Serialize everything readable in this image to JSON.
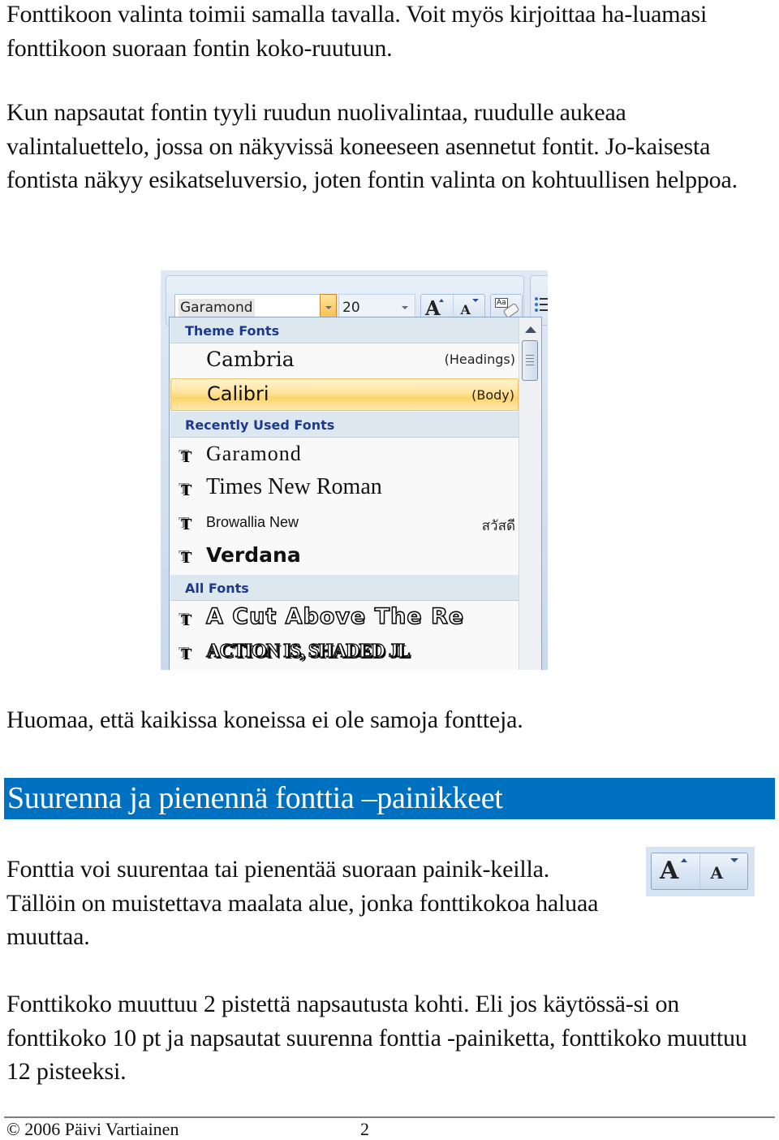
{
  "paragraphs": {
    "p1": "Fonttikoon valinta toimii samalla tavalla. Voit myös kirjoittaa ha-luamasi fonttikoon suoraan fontin koko-ruutuun.",
    "p2": "Kun napsautat fontin tyyli ruudun nuolivalintaa, ruudulle aukeaa valintaluettelo, jossa on näkyvissä koneeseen asennetut fontit. Jo-kaisesta fontista näkyy esikatseluversio, joten fontin valinta on kohtuullisen helppoa.",
    "p3": "Huomaa, että kaikissa koneissa ei ole samoja fontteja.",
    "p4": "Fonttia voi suurentaa tai pienentää suoraan painik-keilla. Tällöin on muistettava maalata alue, jonka fonttikokoa haluaa muuttaa.",
    "p5": "Fonttikoko muuttuu 2 pistettä napsautusta kohti. Eli jos käytössä-si on fonttikoko 10 pt ja napsautat suurenna fonttia -painiketta, fonttikoko muuttuu 12 pisteeksi."
  },
  "font_dropdown_screenshot": {
    "font_name_value": "Garamond",
    "font_size_value": "20",
    "grow_font_glyph": "A",
    "shrink_font_glyph": "A",
    "clear_format_glyph": "Aa",
    "sections": [
      {
        "header": "Theme Fonts",
        "items": [
          {
            "name": "Cambria",
            "tag": "(Headings)",
            "highlighted": false
          },
          {
            "name": "Calibri",
            "tag": "(Body)",
            "highlighted": true
          }
        ]
      },
      {
        "header": "Recently Used Fonts",
        "items": [
          {
            "name": "Garamond",
            "tag": ""
          },
          {
            "name": "Times New Roman",
            "tag": ""
          },
          {
            "name": "Browallia New",
            "tag": "สวัสดี"
          },
          {
            "name": "Verdana",
            "tag": ""
          }
        ]
      },
      {
        "header": "All Fonts",
        "items": [
          {
            "name": "A Cut Above The Re",
            "tag": ""
          },
          {
            "name": "ACTION IS, SHADED JL",
            "tag": ""
          }
        ]
      }
    ],
    "truetype_icon": "T",
    "colors": {
      "section_header_text": "#1d3a8a",
      "section_header_bg": "#dde7f0",
      "highlight": "#fbd46c"
    }
  },
  "heading": {
    "text": "Suurenna ja pienennä fonttia –painikkeet",
    "background": "#0070c0"
  },
  "grow_shrink_image": {
    "grow_glyph": "A",
    "shrink_glyph": "A"
  },
  "footer": {
    "copyright": "© 2006 Päivi Vartiainen",
    "page_number": "2"
  }
}
